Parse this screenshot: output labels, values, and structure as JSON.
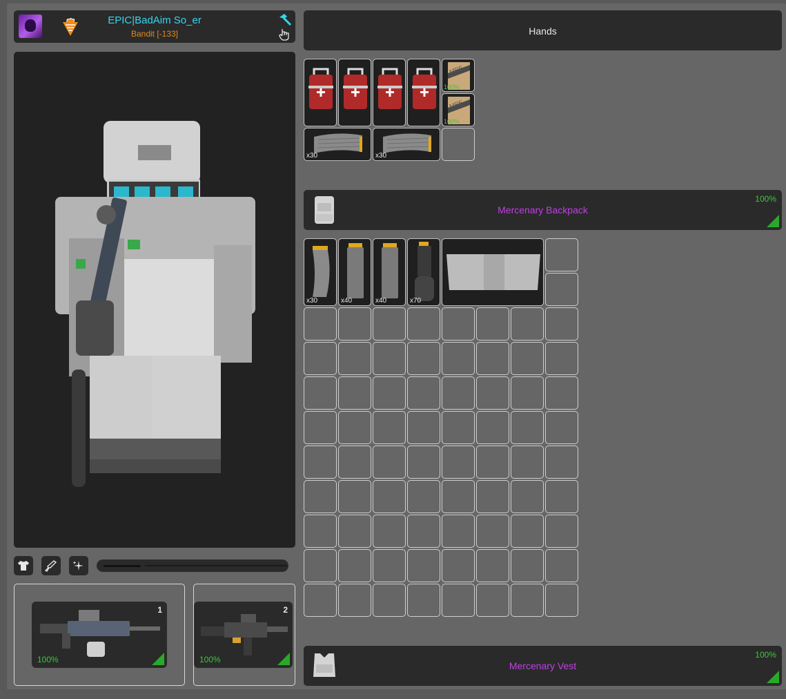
{
  "player": {
    "name": "EPIC|BadAim So_er",
    "title": "Bandit [-133]",
    "avatar_icon": "avatar-icon",
    "faction_icon": "carrot-faction-icon"
  },
  "hands": {
    "label": "Hands"
  },
  "hands_items": [
    {
      "type": "medkit"
    },
    {
      "type": "medkit"
    },
    {
      "type": "medkit"
    },
    {
      "type": "medkit"
    },
    {
      "type": "mre",
      "label": "MRE",
      "durability": "100%"
    },
    {
      "type": "mre",
      "label": "MRE",
      "durability": "100%"
    },
    {
      "type": "magazine",
      "qty": "x30"
    },
    {
      "type": "magazine",
      "qty": "x30"
    }
  ],
  "backpack": {
    "name": "Mercenary Backpack",
    "durability": "100%"
  },
  "backpack_items": [
    {
      "type": "magazine-curved",
      "qty": "x30"
    },
    {
      "type": "magazine-straight",
      "qty": "x40"
    },
    {
      "type": "magazine-straight",
      "qty": "x40"
    },
    {
      "type": "drum-magazine",
      "qty": "x70"
    },
    {
      "type": "armor-plate-carrier"
    }
  ],
  "vest": {
    "name": "Mercenary Vest",
    "durability": "100%"
  },
  "weapons": [
    {
      "slot": "1",
      "durability": "100%",
      "name_icon": "rifle-icon"
    },
    {
      "slot": "2",
      "durability": "100%",
      "name_icon": "smg-icon"
    }
  ],
  "view_controls": [
    "shirt-icon",
    "rifle-icon",
    "sparkle-icon"
  ],
  "colors": {
    "name": "#33d6ee",
    "title": "#e08a1e",
    "equipment_name": "#c13ee6",
    "durability": "#3ec63e",
    "panel": "#2a2a2a",
    "background": "#666666"
  }
}
